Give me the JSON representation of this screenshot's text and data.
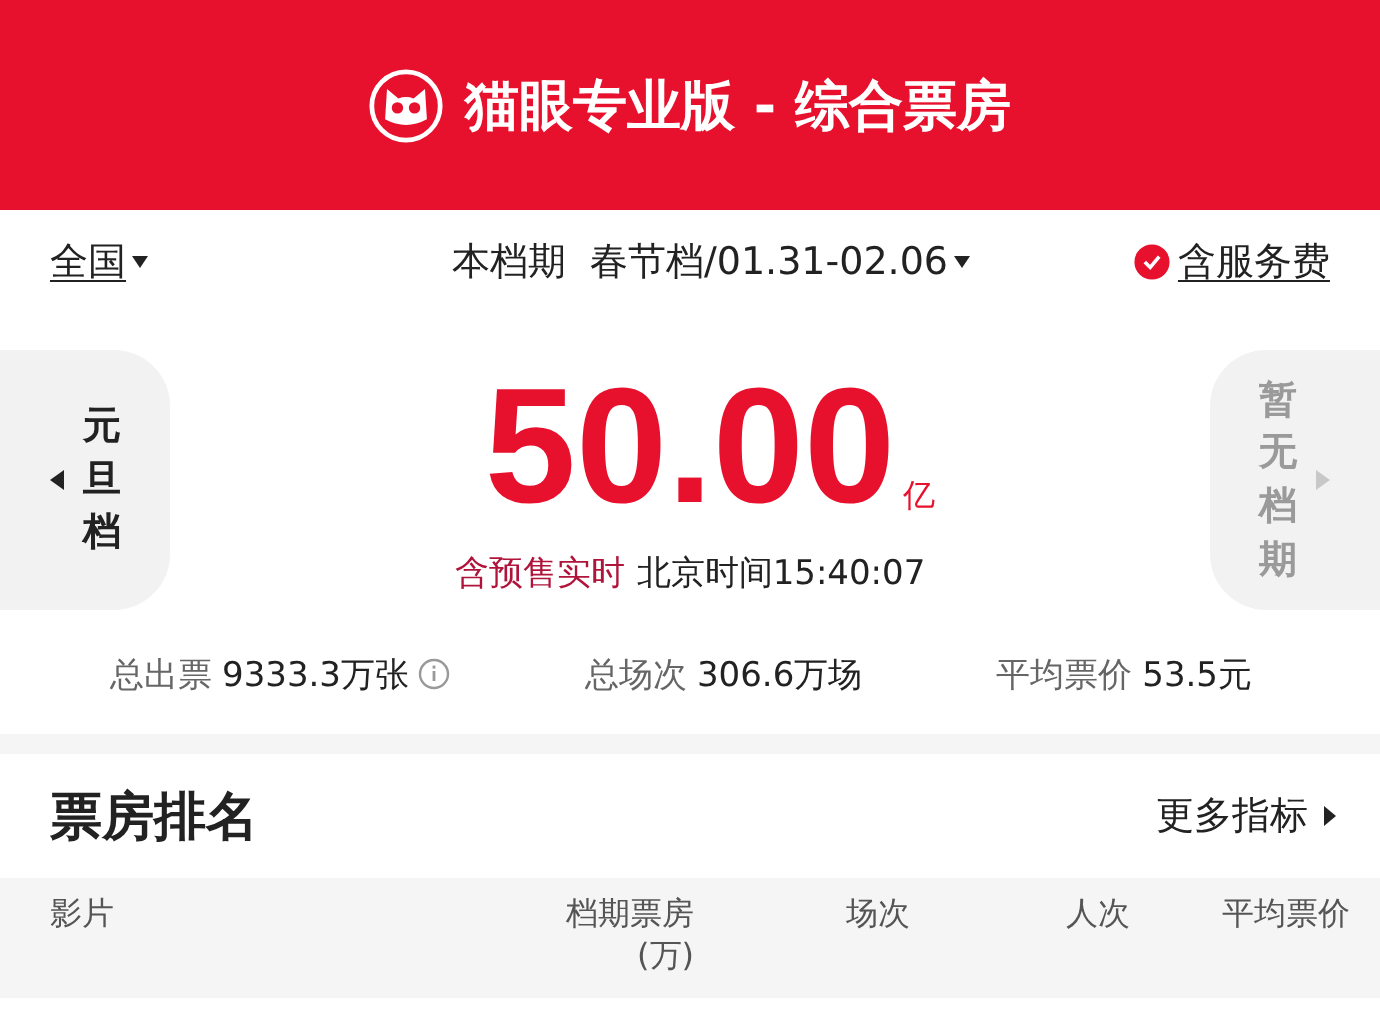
{
  "header": {
    "title": "猫眼专业版 - 综合票房"
  },
  "filters": {
    "region": "全国",
    "period_label": "本档期",
    "period": "春节档/01.31-02.06",
    "service_fee": {
      "label": "含服务费",
      "checked": true
    }
  },
  "prev_period": {
    "label": "元旦档",
    "disabled": false
  },
  "next_period": {
    "label": "暂无档期",
    "disabled": true
  },
  "total": {
    "value": "50.00",
    "unit": "亿",
    "presale_label": "含预售实时",
    "time": "北京时间15:40:07"
  },
  "stats": [
    {
      "label": "总出票",
      "value": "9333.3万张",
      "info": true
    },
    {
      "label": "总场次",
      "value": "306.6万场",
      "info": false
    },
    {
      "label": "平均票价",
      "value": "53.5元",
      "info": false
    }
  ],
  "ranking": {
    "title": "票房排名",
    "more": "更多指标",
    "columns": [
      {
        "label": "影片"
      },
      {
        "label": "档期票房",
        "unit": "(万)"
      },
      {
        "label": "场次"
      },
      {
        "label": "人次"
      },
      {
        "label": "平均票价"
      }
    ]
  }
}
